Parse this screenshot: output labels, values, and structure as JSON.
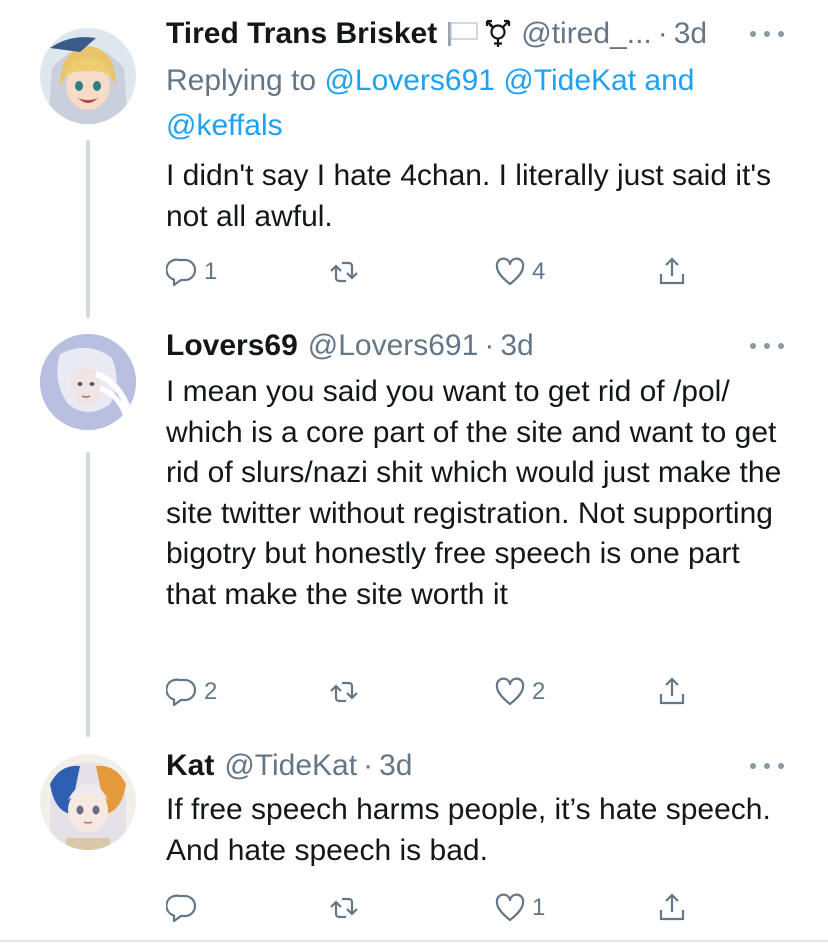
{
  "tweets": [
    {
      "display_name": "Tired Trans Brisket",
      "handle": "@tired_...",
      "separator": "·",
      "time": "3d",
      "replying_prefix": "Replying to",
      "replying_users": [
        "@Lovers691",
        "@TideKat",
        "@keffals"
      ],
      "replying_and": "and",
      "text": "I didn't say I hate 4chan. I literally just said it's not all awful.",
      "reply_count": "1",
      "retweet_count": "",
      "like_count": "4"
    },
    {
      "display_name": "Lovers69",
      "handle": "@Lovers691",
      "separator": "·",
      "time": "3d",
      "text": "I mean you said you want to get rid of /pol/ which is a core part of the site and want to get rid of slurs/nazi shit which would just make the site twitter without registration. Not supporting bigotry but honestly free speech is one part that make the site worth it",
      "reply_count": "2",
      "retweet_count": "",
      "like_count": "2"
    },
    {
      "display_name": "Kat",
      "handle": "@TideKat",
      "separator": "·",
      "time": "3d",
      "text": "If free speech harms people, it’s hate speech. And hate speech is bad.",
      "reply_count": "",
      "retweet_count": "",
      "like_count": "1"
    }
  ],
  "icons": {
    "flag": "white-flag-icon",
    "trans": "transgender-symbol-icon",
    "more": "more-options-icon",
    "reply": "reply-icon",
    "retweet": "retweet-icon",
    "like": "like-icon",
    "share": "share-icon"
  },
  "colors": {
    "link": "#1da1f2",
    "secondary_text": "#657786",
    "thread_line": "#cfd9de"
  }
}
